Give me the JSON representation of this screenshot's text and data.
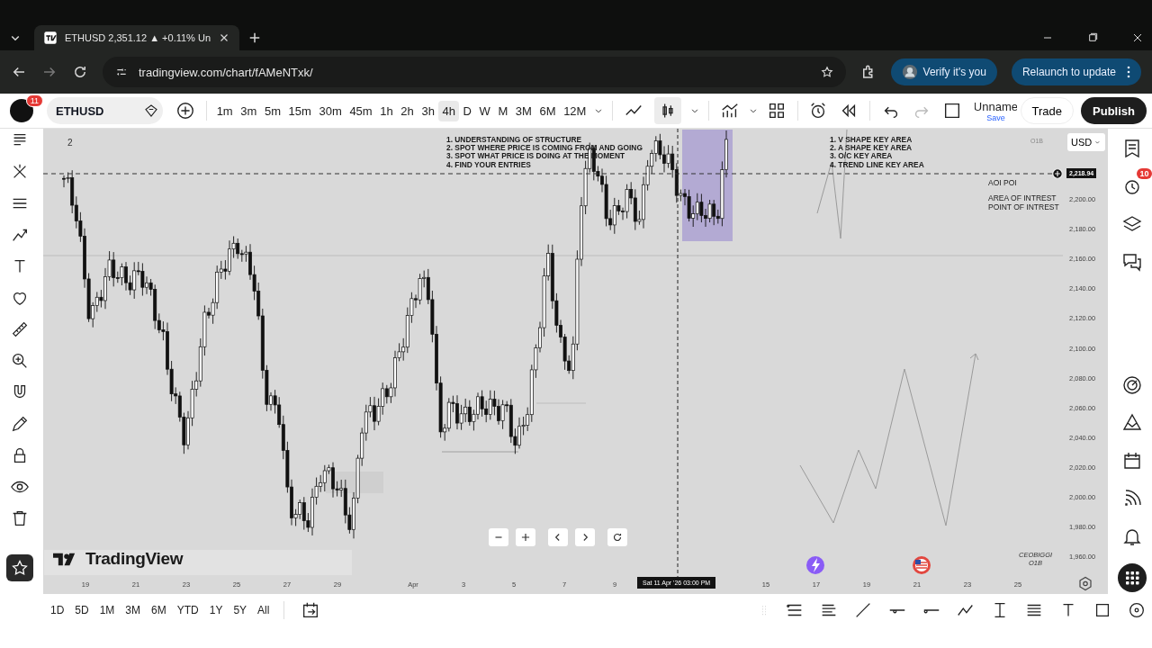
{
  "browser": {
    "tab_title": "ETHUSD 2,351.12 ▲ +0.11% Un",
    "url": "tradingview.com/chart/fAMeNTxk/",
    "verify_button": "Verify it's you",
    "relaunch_button": "Relaunch to update"
  },
  "toolbar": {
    "notification_badge": "11",
    "symbol": "ETHUSD",
    "intervals": [
      {
        "label": "1m",
        "selected": false
      },
      {
        "label": "3m",
        "selected": false
      },
      {
        "label": "5m",
        "selected": false
      },
      {
        "label": "15m",
        "selected": false
      },
      {
        "label": "30m",
        "selected": false
      },
      {
        "label": "45m",
        "selected": false
      },
      {
        "label": "1h",
        "selected": false
      },
      {
        "label": "2h",
        "selected": false
      },
      {
        "label": "3h",
        "selected": false
      },
      {
        "label": "4h",
        "selected": true
      },
      {
        "label": "D",
        "selected": false
      },
      {
        "label": "W",
        "selected": false
      },
      {
        "label": "M",
        "selected": false
      },
      {
        "label": "3M",
        "selected": false
      },
      {
        "label": "6M",
        "selected": false
      },
      {
        "label": "12M",
        "selected": false
      }
    ],
    "layout_name": "Unname",
    "layout_save": "Save",
    "trade_button": "Trade",
    "publish_button": "Publish"
  },
  "chart": {
    "pane_number": "2",
    "notes_left": [
      "1. UNDERSTANDING OF STRUCTURE",
      "2. SPOT WHERE PRICE IS COMING FROM AND GOING",
      "3. SPOT WHAT PRICE IS DOING AT THE MOMENT",
      "4. FIND YOUR ENTRIES"
    ],
    "notes_right": [
      "1. V SHAPE KEY AREA",
      "2. A SHAPE KEY AREA",
      "3. O/C KEY AREA",
      "4. TREND LINE KEY AREA"
    ],
    "tag": "O1B",
    "currency": "USD",
    "price_marker": "2,218.94",
    "zone_label": "AOI POI",
    "zone_notes": [
      "AREA OF INTREST",
      "POINT OF INTREST"
    ],
    "credit": [
      "CEOBIGGI",
      "O1B"
    ],
    "logo": "TradingView",
    "price_ticks": [
      "2,200.00",
      "2,180.00",
      "2,160.00",
      "2,140.00",
      "2,120.00",
      "2,100.00",
      "2,080.00",
      "2,060.00",
      "2,040.00",
      "2,020.00",
      "2,000.00",
      "1,980.00",
      "1,960.00"
    ],
    "time_ticks": [
      "19",
      "21",
      "23",
      "25",
      "27",
      "29",
      "Apr",
      "3",
      "5",
      "7",
      "9",
      "15",
      "17",
      "19",
      "21",
      "23",
      "25"
    ],
    "crosshair_time": "Sat 11 Apr '26  03:00 PM"
  },
  "sidebar": {
    "alerts_badge": "10"
  },
  "ranges": [
    "1D",
    "5D",
    "1M",
    "3M",
    "6M",
    "YTD",
    "1Y",
    "5Y",
    "All"
  ]
}
